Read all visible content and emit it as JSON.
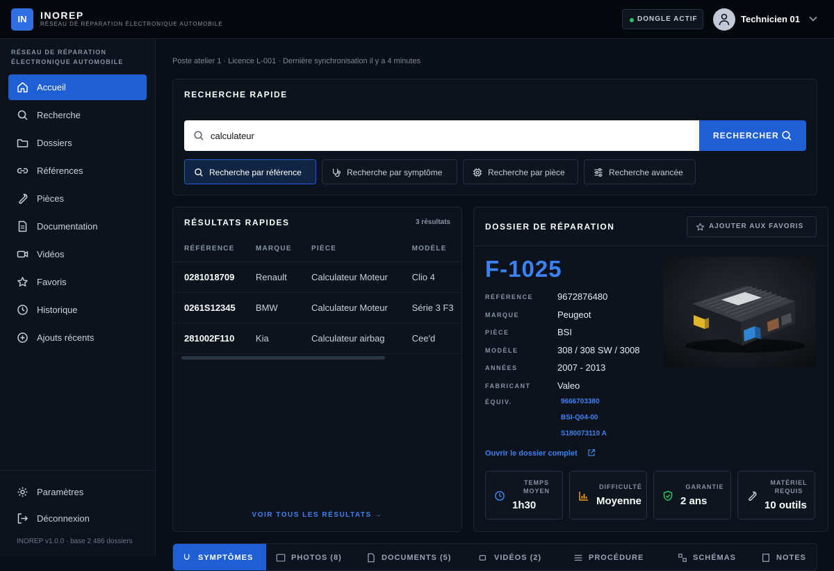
{
  "app": {
    "logo": "IN",
    "name": "INOREP",
    "subtitle": "RÉSEAU DE RÉPARATION ÉLECTRONIQUE AUTOMOBILE"
  },
  "header": {
    "dongle": "DONGLE ACTIF",
    "user": "Technicien 01"
  },
  "sidebar": {
    "title": "RÉSEAU DE RÉPARATION ÉLECTRONIQUE AUTOMOBILE",
    "items": [
      {
        "label": "Accueil",
        "icon": "home-icon"
      },
      {
        "label": "Recherche",
        "icon": "search-icon"
      },
      {
        "label": "Dossiers",
        "icon": "folder-icon"
      },
      {
        "label": "Références",
        "icon": "link-icon"
      },
      {
        "label": "Pièces",
        "icon": "wrench-icon"
      },
      {
        "label": "Documentation",
        "icon": "document-icon"
      },
      {
        "label": "Vidéos",
        "icon": "video-icon"
      },
      {
        "label": "Favoris",
        "icon": "star-icon"
      },
      {
        "label": "Historique",
        "icon": "clock-icon"
      },
      {
        "label": "Ajouts récents",
        "icon": "plus-circle-icon"
      }
    ],
    "bottom": [
      {
        "label": "Paramètres",
        "icon": "gear-icon"
      },
      {
        "label": "Déconnexion",
        "icon": "logout-icon"
      }
    ],
    "footer": "INOREP v1.0.0 · base 2 486 dossiers"
  },
  "status_line": "Poste atelier 1 · Licence L-001 · Dernière synchronisation il y a 4 minutes",
  "quick_search": {
    "title": "RECHERCHE RAPIDE",
    "value": "calculateur",
    "button": "RECHERCHER",
    "modes": [
      {
        "label": "Recherche par référence",
        "icon": "search-icon"
      },
      {
        "label": "Recherche par symptôme",
        "icon": "stethoscope-icon"
      },
      {
        "label": "Recherche par pièce",
        "icon": "chip-icon"
      },
      {
        "label": "Recherche avancée",
        "icon": "sliders-icon"
      }
    ]
  },
  "results": {
    "title": "RÉSULTATS RAPIDES",
    "count": "3 résultats",
    "columns": [
      "RÉFÉRENCE",
      "MARQUE",
      "PIÈCE",
      "MODÈLE"
    ],
    "rows": [
      [
        "0281018709",
        "Renault",
        "Calculateur Moteur",
        "Clio 4"
      ],
      [
        "0261S12345",
        "BMW",
        "Calculateur Moteur",
        "Série 3 F3"
      ],
      [
        "281002F110",
        "Kia",
        "Calculateur airbag",
        "Cee'd"
      ]
    ],
    "view_all": "VOIR TOUS LES RÉSULTATS →"
  },
  "dossier": {
    "title": "DOSSIER DE RÉPARATION",
    "favorite": "AJOUTER AUX FAVORIS",
    "code": "F-1025",
    "fields": [
      {
        "key": "RÉFÉRENCE",
        "value": "9672876480"
      },
      {
        "key": "MARQUE",
        "value": "Peugeot"
      },
      {
        "key": "PIÈCE",
        "value": "BSI"
      },
      {
        "key": "MODÈLE",
        "value": "308 / 308 SW / 3008"
      },
      {
        "key": "ANNÉES",
        "value": "2007 - 2013"
      },
      {
        "key": "FABRICANT",
        "value": "Valeo"
      }
    ],
    "equiv_label": "ÉQUIV.",
    "equiv": [
      "9666703380",
      "BSI-Q04-00",
      "S180073110 A"
    ],
    "open_link": "Ouvrir le dossier complet",
    "stats": [
      {
        "label": "TEMPS MOYEN",
        "value": "1h30",
        "icon": "clock-icon",
        "color": "#3b82f6"
      },
      {
        "label": "DIFFICULTÉ",
        "value": "Moyenne",
        "icon": "bar-chart-icon",
        "color": "#f59e0b"
      },
      {
        "label": "GARANTIE",
        "value": "2 ans",
        "icon": "shield-icon",
        "color": "#22c55e"
      },
      {
        "label": "MATÉRIEL REQUIS",
        "value": "10 outils",
        "icon": "wrench-icon",
        "color": "#c9d0da"
      }
    ]
  },
  "bottom_tabs": [
    "SYMPTÔMES",
    "PHOTOS (8)",
    "DOCUMENTS (5)",
    "VIDÉOS (2)",
    "PROCÉDURE",
    "SCHÉMAS",
    "NOTES"
  ]
}
